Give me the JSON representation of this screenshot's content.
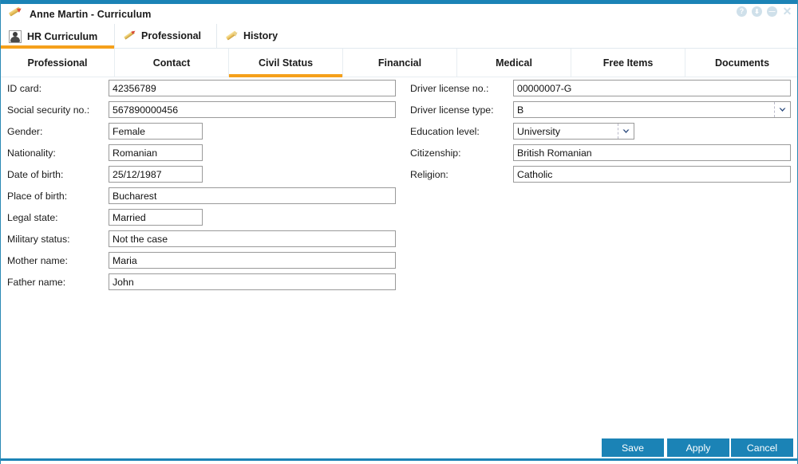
{
  "window": {
    "title": "Anne Martin - Curriculum",
    "title_icon": "pencil-icon",
    "controls": [
      {
        "name": "help-button",
        "glyph": "?"
      },
      {
        "name": "pin-button",
        "glyph": "⬇"
      },
      {
        "name": "restore-button",
        "glyph": "—"
      },
      {
        "name": "close-button",
        "glyph": "✕"
      }
    ]
  },
  "primary_tabs": [
    {
      "label": "HR Curriculum",
      "icon": "person-card-icon",
      "active": true
    },
    {
      "label": "Professional",
      "icon": "pencil-icon",
      "active": false
    },
    {
      "label": "History",
      "icon": "scroll-pen-icon",
      "active": false
    }
  ],
  "secondary_tabs": [
    {
      "label": "Professional",
      "active": false
    },
    {
      "label": "Contact",
      "active": false
    },
    {
      "label": "Civil Status",
      "active": true
    },
    {
      "label": "Financial",
      "active": false
    },
    {
      "label": "Medical",
      "active": false
    },
    {
      "label": "Free Items",
      "active": false
    },
    {
      "label": "Documents",
      "active": false
    }
  ],
  "form": {
    "left": [
      {
        "label": "ID card:",
        "value": "42356789",
        "type": "text",
        "width": "long"
      },
      {
        "label": "Social security no.:",
        "value": "567890000456",
        "type": "text",
        "width": "long"
      },
      {
        "label": "Gender:",
        "value": "Female",
        "type": "text",
        "width": "short"
      },
      {
        "label": "Nationality:",
        "value": "Romanian",
        "type": "text",
        "width": "short"
      },
      {
        "label": "Date of birth:",
        "value": "25/12/1987",
        "type": "text",
        "width": "short"
      },
      {
        "label": "Place of birth:",
        "value": "Bucharest",
        "type": "text",
        "width": "long"
      },
      {
        "label": "Legal state:",
        "value": "Married",
        "type": "text",
        "width": "short"
      },
      {
        "label": "Military status:",
        "value": "Not the case",
        "type": "text",
        "width": "long"
      },
      {
        "label": "Mother name:",
        "value": "Maria",
        "type": "text",
        "width": "long"
      },
      {
        "label": "Father name:",
        "value": "John",
        "type": "text",
        "width": "long"
      }
    ],
    "right": [
      {
        "label": "Driver license no.:",
        "value": "00000007-G",
        "type": "text",
        "width": "long"
      },
      {
        "label": "Driver license type:",
        "value": "B",
        "type": "select",
        "width": "long"
      },
      {
        "label": "Education level:",
        "value": "University",
        "type": "select",
        "width": "short"
      },
      {
        "label": "Citizenship:",
        "value": "British Romanian",
        "type": "text",
        "width": "long"
      },
      {
        "label": "Religion:",
        "value": "Catholic",
        "type": "text",
        "width": "long"
      }
    ]
  },
  "footer": {
    "save_label": "Save",
    "apply_label": "Apply",
    "cancel_label": "Cancel"
  },
  "colors": {
    "accent_blue": "#1b83b6",
    "accent_orange": "#f5a01b",
    "field_border": "#9a9a9a",
    "text": "#1b1b1b"
  }
}
